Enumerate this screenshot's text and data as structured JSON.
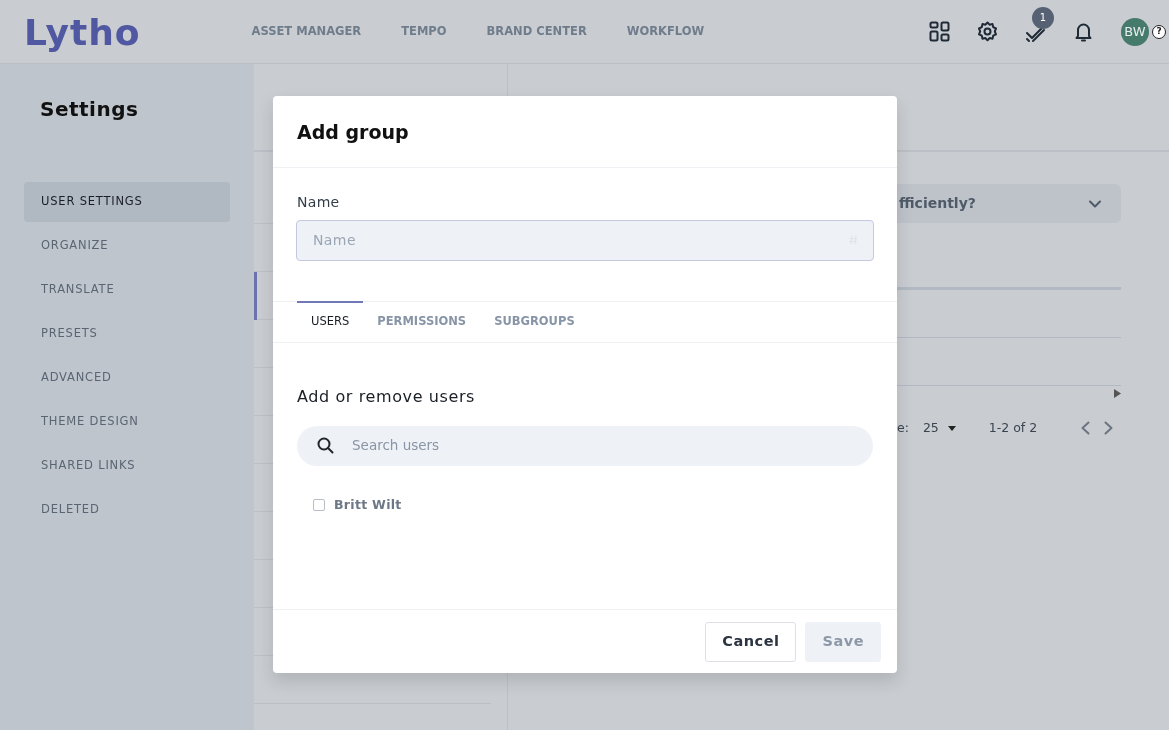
{
  "header": {
    "logo": "Lytho",
    "nav": [
      {
        "label": "ASSET MANAGER"
      },
      {
        "label": "TEMPO"
      },
      {
        "label": "BRAND CENTER"
      },
      {
        "label": "WORKFLOW"
      }
    ],
    "tasks_badge": "1",
    "avatar": "BW",
    "help": "?"
  },
  "sidebar": {
    "title": "Settings",
    "items": [
      {
        "label": "USER SETTINGS",
        "selected": true
      },
      {
        "label": "ORGANIZE",
        "selected": false
      },
      {
        "label": "TRANSLATE",
        "selected": false
      },
      {
        "label": "PRESETS",
        "selected": false
      },
      {
        "label": "ADVANCED",
        "selected": false
      },
      {
        "label": "THEME DESIGN",
        "selected": false
      },
      {
        "label": "SHARED LINKS",
        "selected": false
      },
      {
        "label": "DELETED",
        "selected": false
      }
    ]
  },
  "background": {
    "faq": "fficiently?",
    "pagination": {
      "per_page_label": "e:",
      "per_page": "25",
      "range": "1-2 of 2"
    }
  },
  "dialog": {
    "title": "Add group",
    "name_field": {
      "label": "Name",
      "placeholder": "Name"
    },
    "tabs": [
      {
        "label": "USERS",
        "selected": true
      },
      {
        "label": "PERMISSIONS",
        "selected": false
      },
      {
        "label": "SUBGROUPS",
        "selected": false
      }
    ],
    "section_title": "Add or remove users",
    "search": {
      "placeholder": "Search users"
    },
    "users": [
      {
        "name": "Britt Wilt",
        "checked": false
      }
    ],
    "buttons": [
      {
        "label": "Cancel",
        "disabled": false
      },
      {
        "label": "Save",
        "disabled": true
      }
    ]
  }
}
